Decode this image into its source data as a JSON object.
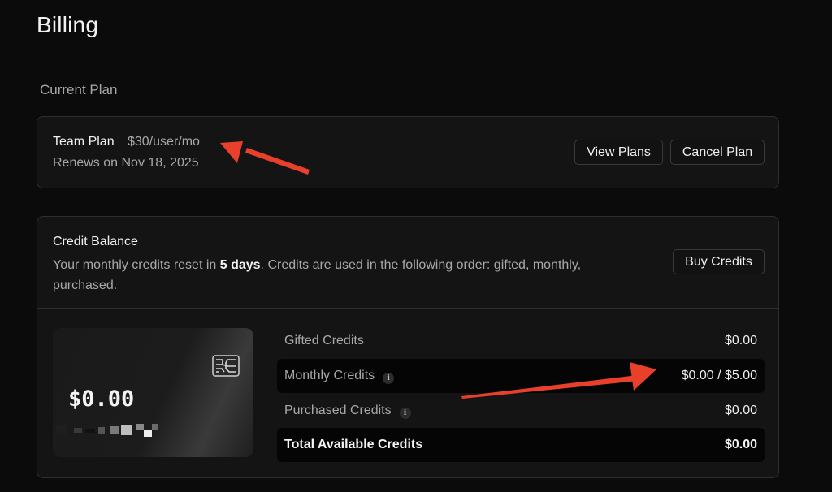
{
  "page": {
    "title": "Billing"
  },
  "current_plan": {
    "section_label": "Current Plan",
    "plan_name": "Team Plan",
    "plan_price": "$30/user/mo",
    "renewal": "Renews on Nov 18, 2025",
    "view_plans_label": "View Plans",
    "cancel_plan_label": "Cancel Plan"
  },
  "credit_balance": {
    "title": "Credit Balance",
    "desc_prefix": "Your monthly credits reset in ",
    "desc_days": "5 days",
    "desc_suffix": ". Credits are used in the following order: gifted, monthly, purchased.",
    "buy_credits_label": "Buy Credits",
    "card_balance": "$0.00",
    "rows": [
      {
        "label": "Gifted Credits",
        "value": "$0.00"
      },
      {
        "label": "Monthly Credits",
        "value": "$0.00 / $5.00",
        "info_icon": "info-icon"
      },
      {
        "label": "Purchased Credits",
        "value": "$0.00",
        "info_icon": "info-icon"
      },
      {
        "label": "Total Available Credits",
        "value": "$0.00"
      }
    ],
    "info_glyph": "i"
  },
  "colors": {
    "background": "#0b0b0b",
    "card": "#141414",
    "border": "#2e2e2e",
    "annotation_arrow": "#e8402a"
  }
}
